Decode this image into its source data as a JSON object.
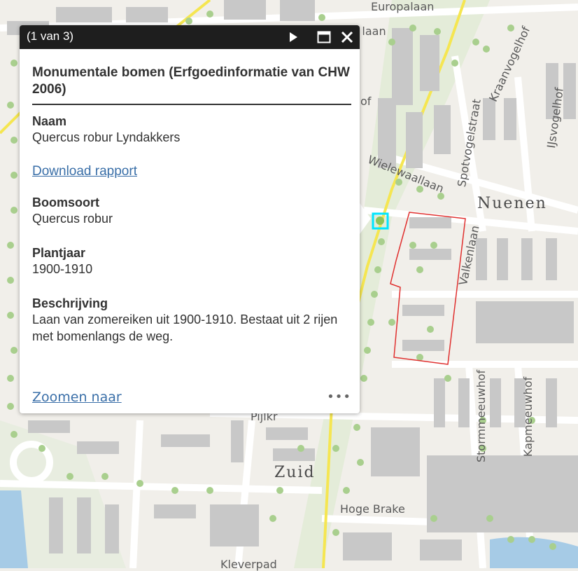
{
  "map": {
    "labels": {
      "europalaan": "Europalaan",
      "dal": "D    laan",
      "of": "of",
      "kraanvogelhof": "Kraanvogelhof",
      "ijsvogelhof": "IJsvogelhof",
      "spotvogelstraat": "Spotvogelstraat",
      "wielewaallaan": "Wielewaallaan",
      "valkenlaan": "Valkenlaan",
      "nuenen": "Nuenen",
      "stormmeeuwhof": "Stormmeeuwhof",
      "kapmeeuwhof": "Kapmeeuwhof",
      "zuid": "Zuid",
      "hoge_brake": "Hoge Brake",
      "pijlkr": "Pijlkr",
      "kleverpad": "Kleverpad"
    },
    "colors": {
      "background": "#f1efea",
      "building": "#c8c8c8",
      "tree": "#a9cf8e",
      "road": "#ffffff",
      "main_road": "#f5e651",
      "water": "#a6cbe6",
      "parcel_outline": "#e0302f",
      "selection": "#00e5ff"
    }
  },
  "popup": {
    "counter": "(1 van 3)",
    "title": "Monumentale bomen (Erfgoedinformatie van CHW 2006)",
    "fields": {
      "naam": {
        "label": "Naam",
        "value": "Quercus robur Lyndakkers"
      },
      "download": "Download rapport",
      "boomsoort": {
        "label": "Boomsoort",
        "value": "Quercus robur"
      },
      "plantjaar": {
        "label": "Plantjaar",
        "value": "1900-1910"
      },
      "beschrijving": {
        "label": "Beschrijving",
        "value": "Laan van zomereiken uit 1900-1910. Bestaat uit 2 rijen met bomenlangs de weg."
      }
    },
    "zoom_link": "Zoomen naar",
    "more": "•••",
    "icons": [
      "play-icon",
      "maximize-icon",
      "close-icon",
      "more-icon"
    ]
  }
}
